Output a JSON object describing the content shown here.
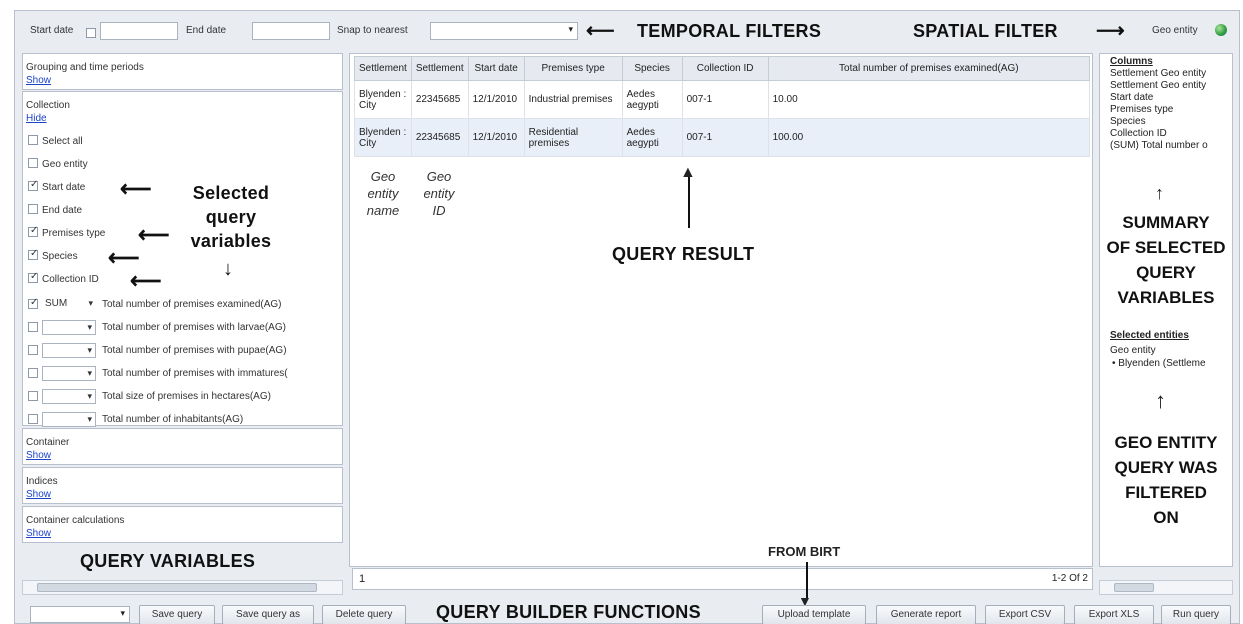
{
  "toolbar": {
    "start_date_label": "Start date",
    "end_date_label": "End date",
    "snap_label": "Snap to nearest",
    "geo_entity_label": "Geo entity"
  },
  "annotations": {
    "temporal": "TEMPORAL FILTERS",
    "spatial": "SPATIAL FILTER",
    "selected_vars": [
      "Selected",
      "query",
      "variables"
    ],
    "query_variables": "QUERY VARIABLES",
    "query_result": "QUERY RESULT",
    "from_birt": "FROM BIRT",
    "builder_functions": "QUERY BUILDER FUNCTIONS",
    "summary": [
      "SUMMARY",
      "OF SELECTED",
      "QUERY",
      "VARIABLES"
    ],
    "geo_filtered": [
      "GEO ENTITY",
      "QUERY WAS",
      "FILTERED",
      "ON"
    ],
    "geo_entity_name": [
      "Geo",
      "entity",
      "name"
    ],
    "geo_entity_id": [
      "Geo",
      "entity",
      "ID"
    ]
  },
  "left": {
    "grouping": {
      "title": "Grouping and time periods",
      "link": "Show"
    },
    "collection": {
      "title": "Collection",
      "link": "Hide",
      "items": [
        {
          "label": "Select all",
          "checked": false
        },
        {
          "label": "Geo entity",
          "checked": false
        },
        {
          "label": "Start date",
          "checked": true
        },
        {
          "label": "End date",
          "checked": false
        },
        {
          "label": "Premises type",
          "checked": true
        },
        {
          "label": "Species",
          "checked": true
        },
        {
          "label": "Collection ID",
          "checked": true
        }
      ],
      "agg_items": [
        {
          "agg": "SUM",
          "label": "Total number of premises examined(AG)",
          "checked": true
        },
        {
          "agg": "",
          "label": "Total number of premises with larvae(AG)",
          "checked": false
        },
        {
          "agg": "",
          "label": "Total number of premises with pupae(AG)",
          "checked": false
        },
        {
          "agg": "",
          "label": "Total number of premises with immatures(",
          "checked": false
        },
        {
          "agg": "",
          "label": "Total size of premises in hectares(AG)",
          "checked": false
        },
        {
          "agg": "",
          "label": "Total number of inhabitants(AG)",
          "checked": false
        }
      ]
    },
    "container": {
      "title": "Container",
      "link": "Show"
    },
    "indices": {
      "title": "Indices",
      "link": "Show"
    },
    "container_calc": {
      "title": "Container calculations",
      "link": "Show"
    }
  },
  "table": {
    "headers": [
      "Settlement",
      "Settlement",
      "Start date",
      "Premises type",
      "Species",
      "Collection ID",
      "Total number of premises examined(AG)"
    ],
    "rows": [
      [
        "Blyenden : City",
        "22345685",
        "12/1/2010",
        "Industrial premises",
        "Aedes aegypti",
        "007-1",
        "10.00"
      ],
      [
        "Blyenden : City",
        "22345685",
        "12/1/2010",
        "Residential premises",
        "Aedes aegypti",
        "007-1",
        "100.00"
      ]
    ],
    "page": "1",
    "count": "1-2 Of 2"
  },
  "right": {
    "columns_title": "Columns",
    "columns": [
      "Settlement Geo entity",
      "Settlement Geo entity",
      "Start date",
      "Premises type",
      "Species",
      "Collection ID",
      "(SUM) Total number o"
    ],
    "selected_title": "Selected entities",
    "selected_sub": "Geo entity",
    "selected_item": "• Blyenden (Settleme"
  },
  "bottom": {
    "save_query": "Save query",
    "save_query_as": "Save query as",
    "delete_query": "Delete query",
    "upload_template": "Upload template",
    "generate_report": "Generate report",
    "export_csv": "Export CSV",
    "export_xls": "Export XLS",
    "run_query": "Run query"
  }
}
